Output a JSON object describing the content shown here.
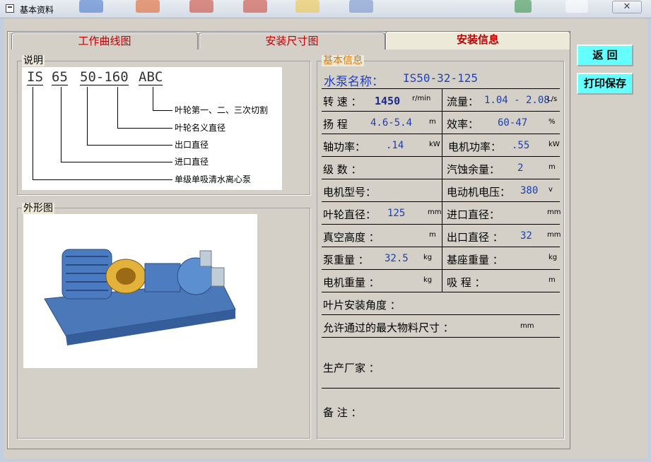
{
  "window": {
    "title": "基本资料",
    "close_glyph": "✕"
  },
  "tabs": [
    {
      "label": "工作曲线图"
    },
    {
      "label": "安装尺寸图"
    },
    {
      "label": "安装信息"
    }
  ],
  "explanation": {
    "legend": "说明",
    "code_parts": [
      "IS",
      "65",
      "50-160",
      "ABC"
    ],
    "annotations": [
      "叶轮第一、二、三次切割",
      "叶轮名义直径",
      "出口直径",
      "进口直径",
      "单级单吸清水离心泵"
    ]
  },
  "appearance": {
    "legend": "外形图",
    "image_icon": "pump-photo"
  },
  "basic_info": {
    "legend": "基本信息",
    "pump_name_label": "水泵名称：",
    "pump_model": "IS50-32-125",
    "rows": [
      {
        "left_label": "转 速 ：",
        "left_value": "1450",
        "left_unit": "r/min",
        "right_label": "流量：",
        "right_value": "1.04 - 2.08",
        "right_unit": "L/s"
      },
      {
        "left_label": "扬 程",
        "left_value": "4.6-5.4",
        "left_unit": "m",
        "right_label": "效率：",
        "right_value": "60-47",
        "right_unit": "%"
      },
      {
        "left_label": "轴功率：",
        "left_value": ".14",
        "left_unit": "kW",
        "right_label": "电机功率：",
        "right_value": ".55",
        "right_unit": "kW"
      },
      {
        "left_label": "级 数 ：",
        "left_value": "",
        "left_unit": "",
        "right_label": "汽蚀余量：",
        "right_value": "2",
        "right_unit": "m"
      },
      {
        "left_label": "电机型号：",
        "left_value": "",
        "left_unit": "",
        "right_label": "电动机电压：",
        "right_value": "380",
        "right_unit": "v"
      },
      {
        "left_label": "叶轮直径：",
        "left_value": "125",
        "left_unit": "mm",
        "right_label": "进口直径：",
        "right_value": "",
        "right_unit": "mm"
      },
      {
        "left_label": "真空高度 ：",
        "left_value": "",
        "left_unit": "m",
        "right_label": "出口直径 ：",
        "right_value": "32",
        "right_unit": "mm"
      },
      {
        "left_label": "泵重量 ：",
        "left_value": "32.5",
        "left_unit": "kg",
        "right_label": "基座重量 ：",
        "right_value": "",
        "right_unit": "kg"
      },
      {
        "left_label": "电机重量 ：",
        "left_value": "",
        "left_unit": "kg",
        "right_label": "吸 程 ：",
        "right_value": "",
        "right_unit": "m"
      }
    ],
    "blade_angle_label": "叶片安装角度 ：",
    "max_particle_label": "允许通过的最大物料尺寸 ：",
    "max_particle_unit": "mm",
    "manufacturer_label": "生产厂家 ：",
    "remarks_label": "备 注 ："
  },
  "buttons": {
    "back": "返 回",
    "print_save": "打印保存"
  }
}
